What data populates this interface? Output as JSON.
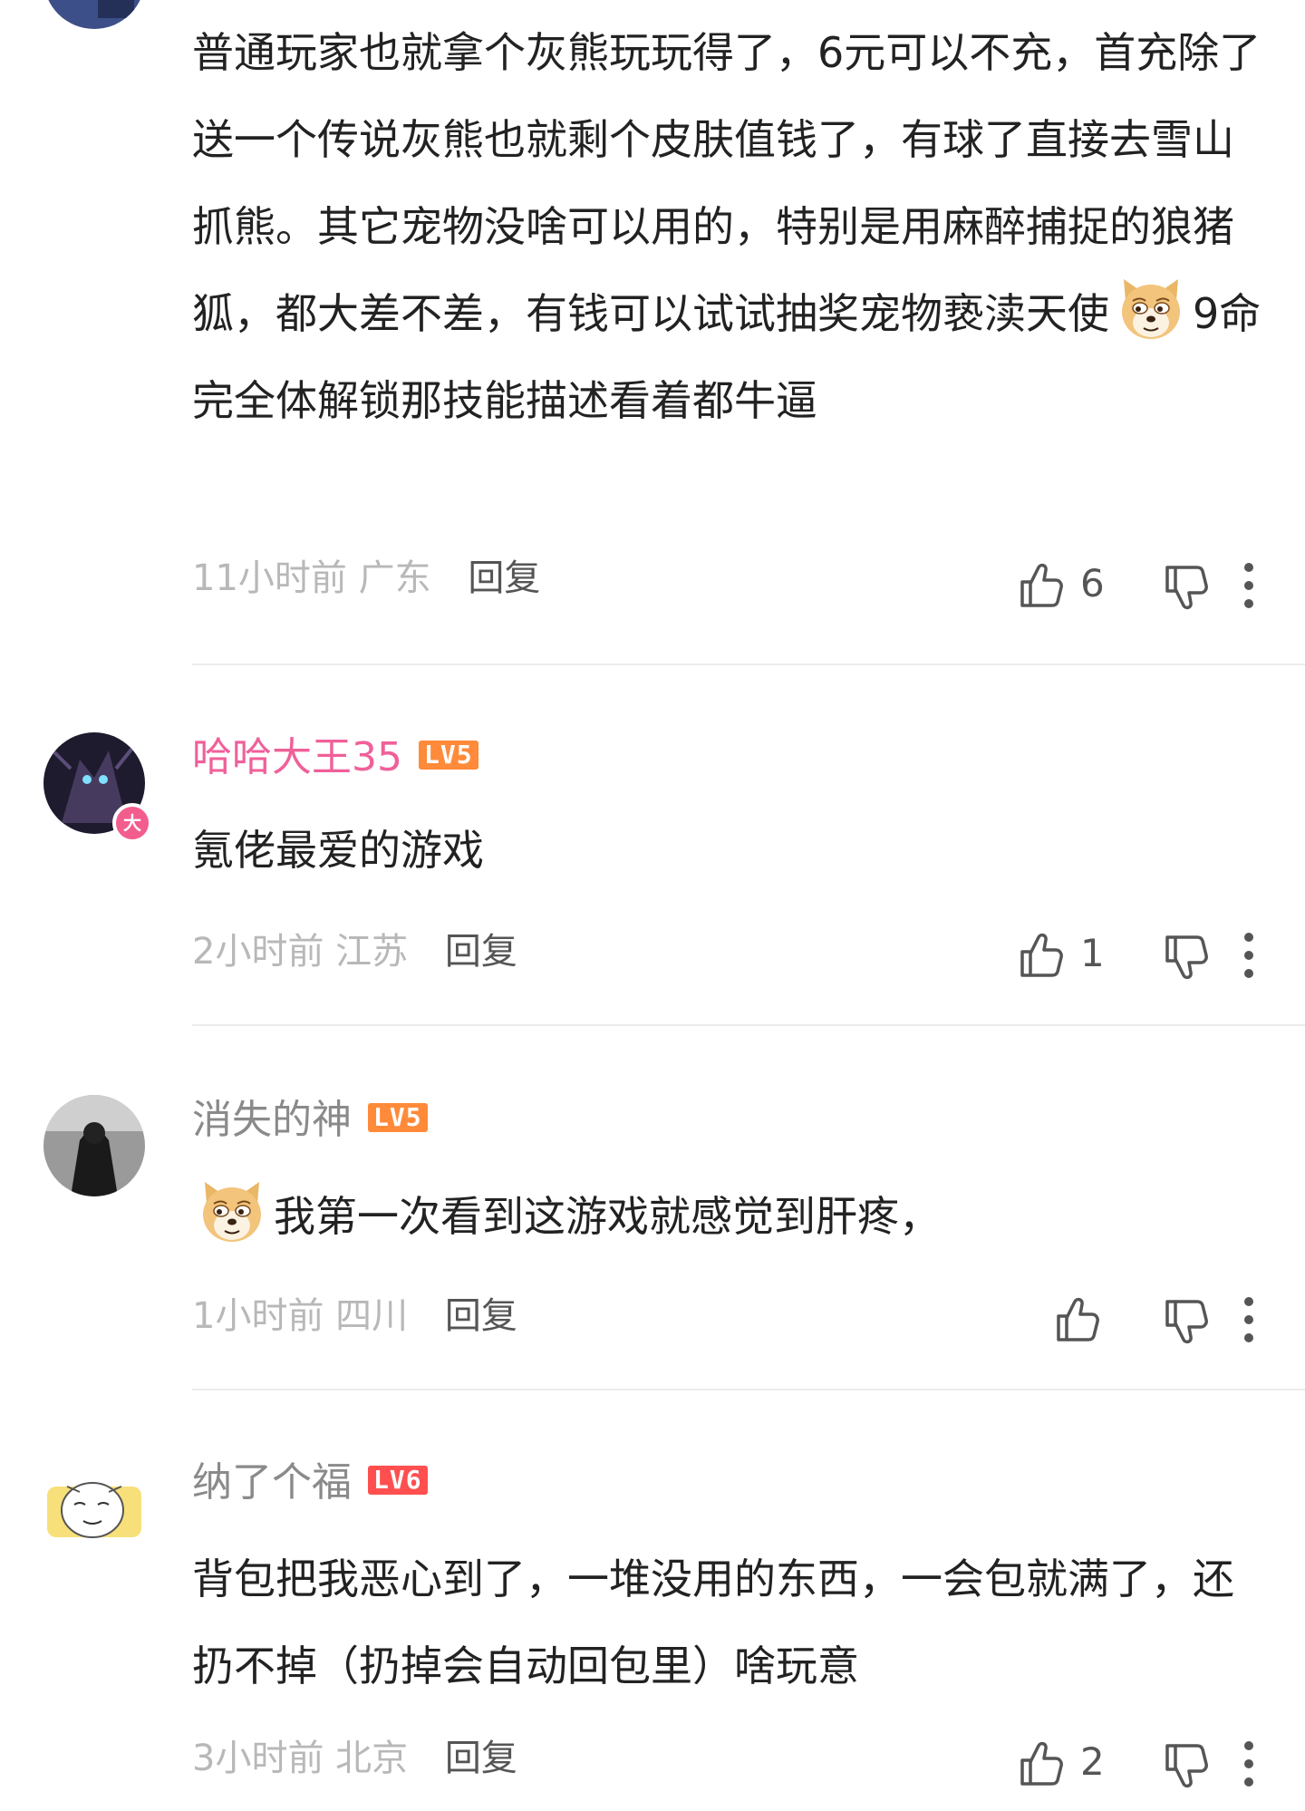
{
  "comments": [
    {
      "text_part1": "普通玩家也就拿个灰熊玩玩得了，6元可以不充，首充除了送一个传说灰熊也就剩个皮肤值钱了，有球了直接去雪山抓熊。其它宠物没啥可以用的，特别是用麻醉捕捉的狼猪狐，都大差不差，有钱可以试试抽奖宠物亵渎天使",
      "text_part2": "9命完全体解锁那技能描述看着都牛逼",
      "emoji": "doge-emoji",
      "time": "11小时前",
      "location": "广东",
      "reply": "回复",
      "likes": "6"
    },
    {
      "username": "哈哈大王35",
      "level": "LV5",
      "badge": "大",
      "text": "氪佬最爱的游戏",
      "time": "2小时前",
      "location": "江苏",
      "reply": "回复",
      "likes": "1"
    },
    {
      "username": "消失的神",
      "level": "LV5",
      "emoji": "doge-emoji",
      "text": "我第一次看到这游戏就感觉到肝疼，",
      "time": "1小时前",
      "location": "四川",
      "reply": "回复",
      "likes": ""
    },
    {
      "username": "纳了个福",
      "level": "LV6",
      "text": "背包把我恶心到了，一堆没用的东西，一会包就满了，还扔不掉（扔掉会自动回包里）啥玩意",
      "time": "3小时前",
      "location": "北京",
      "reply": "回复",
      "likes": "2"
    }
  ],
  "colors": {
    "vip_name": "#f0609a",
    "name": "#8a8a8a",
    "meta": "#b8b8b8",
    "lv5": "#ff8a3a",
    "lv6": "#ff4f4f"
  },
  "icons": [
    "thumbs-up-icon",
    "thumbs-down-icon",
    "more-vertical-icon",
    "doge-emoji"
  ]
}
